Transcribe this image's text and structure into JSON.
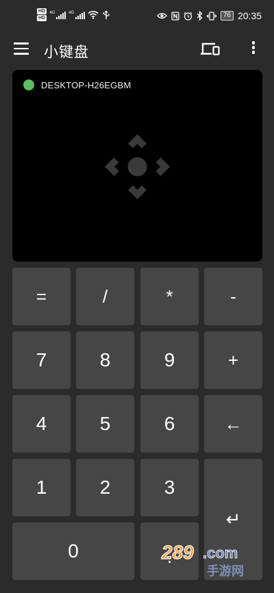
{
  "status_bar": {
    "hd_label": "HD",
    "net1": "4G",
    "net2": "4G",
    "battery": "76",
    "time": "20:35"
  },
  "app_bar": {
    "title": "小键盘"
  },
  "touchpad": {
    "device_name": "DESKTOP-H26EGBM",
    "status_color": "#5cc05e"
  },
  "keypad": {
    "keys": {
      "equals": "=",
      "divide": "/",
      "multiply": "*",
      "minus": "-",
      "seven": "7",
      "eight": "8",
      "nine": "9",
      "plus": "+",
      "four": "4",
      "five": "5",
      "six": "6",
      "backspace": "←",
      "one": "1",
      "two": "2",
      "three": "3",
      "enter": "↵",
      "zero": "0",
      "decimal": "."
    }
  },
  "watermark": {
    "number": "289",
    "domain": ".com",
    "caption": "手游网"
  },
  "colors": {
    "background": "#2b2b2b",
    "key": "#464646",
    "touchpad": "#000000",
    "connected": "#5cc05e",
    "watermark_orange": "#f29a2e",
    "watermark_blue": "#6a7fae"
  }
}
